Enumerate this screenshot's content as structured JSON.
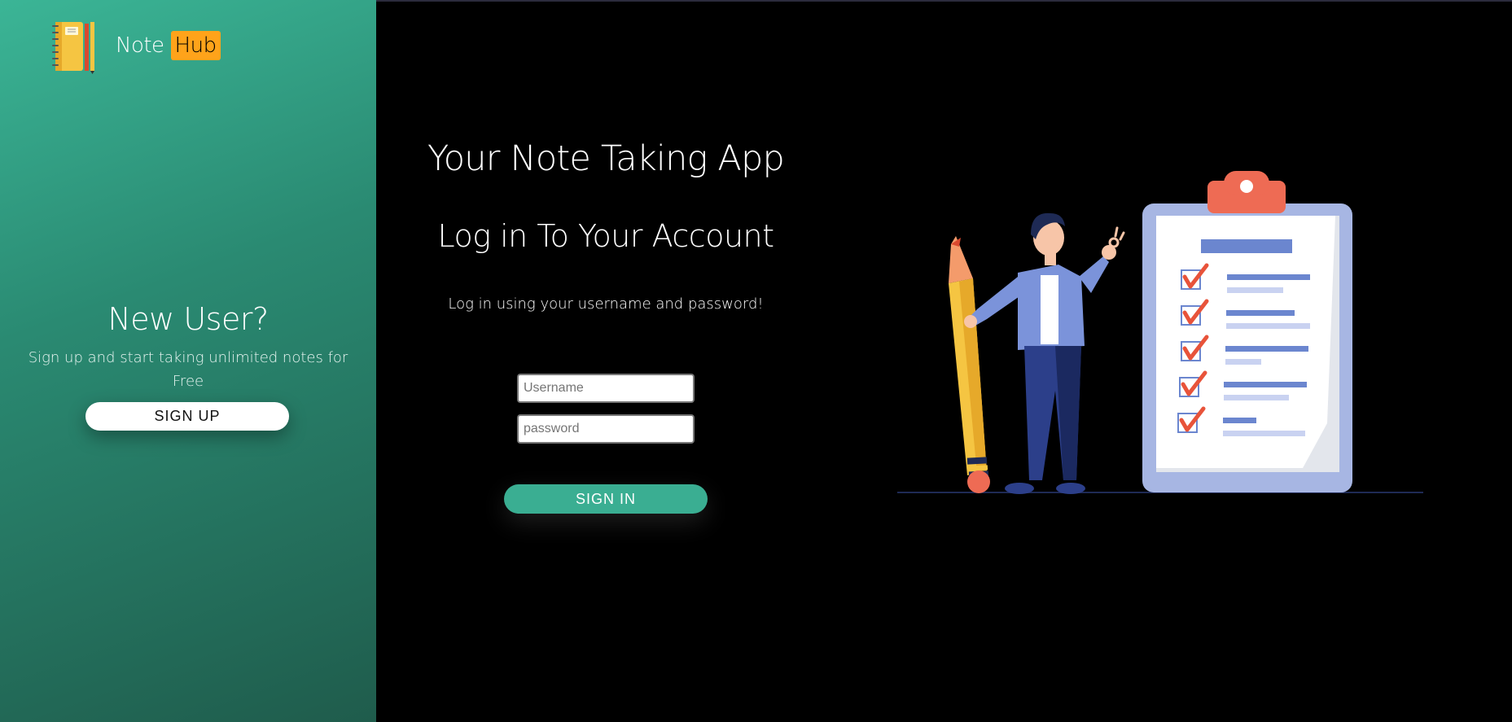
{
  "brand": {
    "name_part1": "Note",
    "name_part2": "Hub",
    "accent": "#ffa31a"
  },
  "sidebar": {
    "title": "New User?",
    "subtitle": "Sign up and start taking unlimited notes for Free",
    "signup_label": "SIGN UP",
    "gradient": [
      "#3bb596",
      "#1f5c4c"
    ]
  },
  "main": {
    "app_title": "Your Note Taking App",
    "login_title": "Log in To Your Account",
    "login_hint": "Log in using your username and password!",
    "username": {
      "placeholder": "Username",
      "value": ""
    },
    "password": {
      "placeholder": "password",
      "value": ""
    },
    "signin_label": "SIGN IN",
    "button_color": "#3aae92"
  },
  "illustration": {
    "icon": "person-with-pencil-and-checklist-illustration"
  }
}
